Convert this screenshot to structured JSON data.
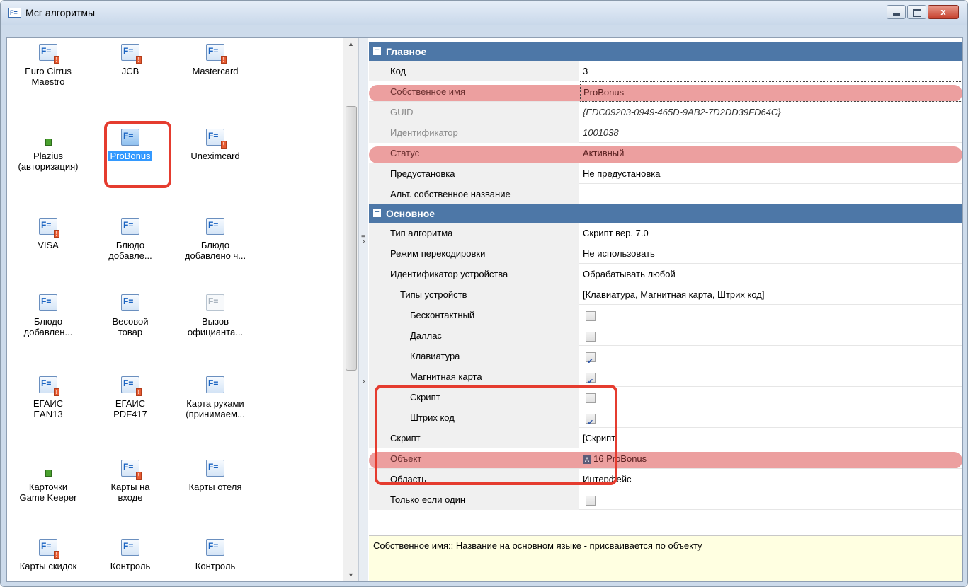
{
  "window": {
    "title": "Мсг алгоритмы",
    "icon": "F=",
    "controls": {
      "minimize": "minimize-icon",
      "maximize": "maximize-icon",
      "close": "x"
    }
  },
  "icons": [
    {
      "label": "Euro Cirrus\nMaestro",
      "icon": "script-error-icon",
      "selected": false
    },
    {
      "label": "JCB",
      "icon": "script-error-icon",
      "selected": false
    },
    {
      "label": "Mastercard",
      "icon": "script-error-icon",
      "selected": false
    },
    {
      "label": "Plazius\n(авторизация)",
      "icon": "green-small-icon",
      "selected": false
    },
    {
      "label": "ProBonus",
      "icon": "script-icon",
      "selected": true
    },
    {
      "label": "Uneximcard",
      "icon": "script-error-icon",
      "selected": false
    },
    {
      "label": "VISA",
      "icon": "script-error-icon",
      "selected": false
    },
    {
      "label": "Блюдо\nдобавле...",
      "icon": "script-icon",
      "selected": false
    },
    {
      "label": "Блюдо\nдобавлено ч...",
      "icon": "script-icon",
      "selected": false
    },
    {
      "label": "Блюдо\nдобавлен...",
      "icon": "script-icon",
      "selected": false
    },
    {
      "label": "Весовой\nтовар",
      "icon": "script-icon",
      "selected": false
    },
    {
      "label": "Вызов\nофицианта...",
      "icon": "script-gray-icon",
      "selected": false
    },
    {
      "label": "ЕГАИС\nEAN13",
      "icon": "script-error-icon",
      "selected": false
    },
    {
      "label": "ЕГАИС\nPDF417",
      "icon": "script-error-icon",
      "selected": false
    },
    {
      "label": "Карта руками\n(принимаем...",
      "icon": "script-icon",
      "selected": false
    },
    {
      "label": "Карточки\nGame Keeper",
      "icon": "green-small-icon",
      "selected": false
    },
    {
      "label": "Карты на\nвходе",
      "icon": "script-error-icon",
      "selected": false
    },
    {
      "label": "Карты отеля",
      "icon": "script-icon",
      "selected": false
    },
    {
      "label": "Карты скидок",
      "icon": "script-error-icon",
      "selected": false
    },
    {
      "label": "Контроль",
      "icon": "script-icon",
      "selected": false
    },
    {
      "label": "Контроль",
      "icon": "script-icon",
      "selected": false
    }
  ],
  "grid": {
    "categories": {
      "main": "Главное",
      "basic": "Основное"
    },
    "rows": {
      "code": {
        "name": "Код",
        "value": "3"
      },
      "own_name": {
        "name": "Собственное имя",
        "value": "ProBonus"
      },
      "guid": {
        "name": "GUID",
        "value": "{EDC09203-0949-465D-9AB2-7D2DD39FD64C}"
      },
      "identifier": {
        "name": "Идентификатор",
        "value": "1001038"
      },
      "status": {
        "name": "Статус",
        "value": "Активный"
      },
      "preinstall": {
        "name": "Предустановка",
        "value": "Не предустановка"
      },
      "alt_name": {
        "name": "Альт. собственное название",
        "value": ""
      },
      "algo_type": {
        "name": "Тип алгоритма",
        "value": "Скрипт вер. 7.0"
      },
      "recode": {
        "name": "Режим перекодировки",
        "value": "Не использовать"
      },
      "device_id": {
        "name": "Идентификатор устройства",
        "value": "Обрабатывать любой"
      },
      "device_types": {
        "name": "Типы устройств",
        "value": "[Клавиатура, Магнитная карта, Штрих код]"
      },
      "contactless": {
        "name": "Бесконтактный",
        "checked": false
      },
      "dallas": {
        "name": "Даллас",
        "checked": false
      },
      "keyboard": {
        "name": "Клавиатура",
        "checked": true
      },
      "magcard": {
        "name": "Магнитная карта",
        "checked": true
      },
      "script_chk": {
        "name": "Скрипт",
        "checked": false
      },
      "barcode": {
        "name": "Штрих код",
        "checked": true
      },
      "script": {
        "name": "Скрипт",
        "value": "[Скрипт]"
      },
      "object": {
        "name": "Объект",
        "value": "16 ProBonus"
      },
      "area": {
        "name": "Область",
        "value": "Интерфейс"
      },
      "only_one": {
        "name": "Только если один",
        "checked": false
      }
    }
  },
  "help_text": "Собственное имя:: Название на основном языке - присваивается по объекту"
}
